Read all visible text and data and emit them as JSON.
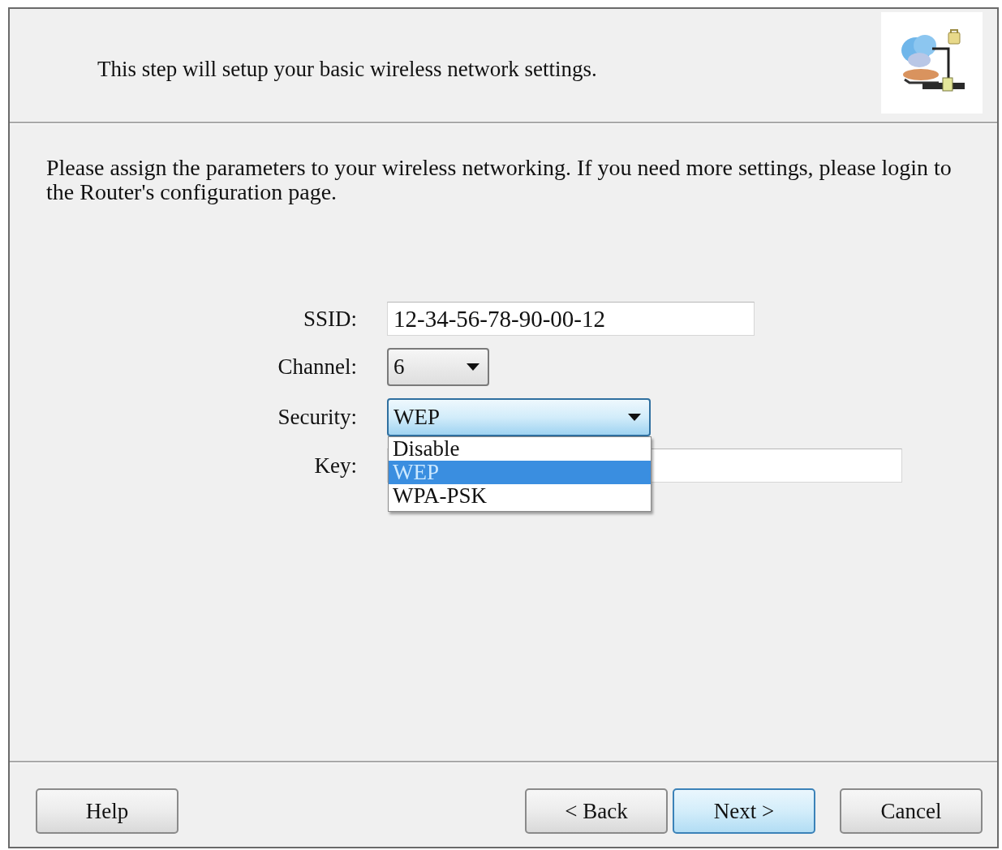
{
  "header": {
    "description": "This step will setup your basic wireless network settings."
  },
  "instructions": "Please assign the parameters to your wireless networking. If you need more settings, please login to the Router's configuration page.",
  "fields": [
    {
      "kind": "text",
      "label": "SSID:",
      "value": "12-34-56-78-90-00-12"
    },
    {
      "kind": "select",
      "label": "Channel:",
      "value": "6",
      "focused": false,
      "expanded": false
    },
    {
      "kind": "select",
      "label": "Security:",
      "value": "WEP",
      "focused": true,
      "expanded": true,
      "options": [
        {
          "label": "Disable",
          "selected": false
        },
        {
          "label": "WEP",
          "selected": true
        },
        {
          "label": "WPA-PSK",
          "selected": false
        }
      ]
    },
    {
      "kind": "text",
      "label": "Key:"
    }
  ],
  "buttons": [
    {
      "label": "Help",
      "default": false
    },
    {
      "label": "< Back",
      "default": false
    },
    {
      "label": "Next >",
      "default": true
    },
    {
      "label": "Cancel",
      "default": false
    }
  ]
}
